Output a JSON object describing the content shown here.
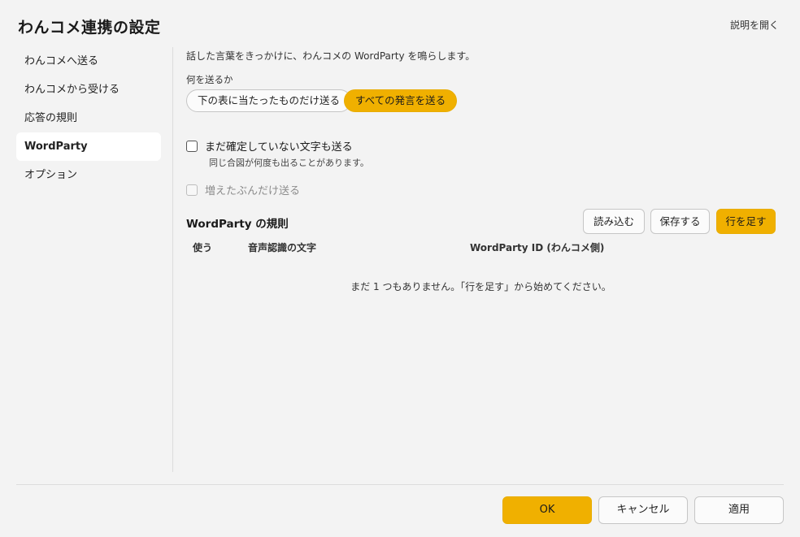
{
  "window": {
    "title": "わんコメ連携の設定",
    "help_link": "説明を開く"
  },
  "sidebar": {
    "items": [
      {
        "label": "わんコメへ送る",
        "active": false
      },
      {
        "label": "わんコメから受ける",
        "active": false
      },
      {
        "label": "応答の規則",
        "active": false
      },
      {
        "label": "WordParty",
        "active": true
      },
      {
        "label": "オプション",
        "active": false
      }
    ]
  },
  "main": {
    "description": "話した言葉をきっかけに、わんコメの WordParty を鳴らします。",
    "send_mode": {
      "label": "何を送るか",
      "options": [
        "下の表に当たったものだけ送る",
        "すべての発言を送る"
      ],
      "selected": "すべての発言を送る"
    },
    "send_unconfirmed": {
      "label": "まだ確定していない文字も送る",
      "hint": "同じ合図が何度も出ることがあります。",
      "checked": false
    },
    "send_increment": {
      "label": "増えたぶんだけ送る",
      "checked": false,
      "disabled": true
    },
    "rules": {
      "title": "WordParty の規則",
      "buttons": {
        "load": "読み込む",
        "save": "保存する",
        "add_row": "行を足す"
      },
      "columns": [
        "使う",
        "音声認識の文字",
        "WordParty ID (わんコメ側)"
      ],
      "rows": [],
      "empty_message": "まだ 1 つもありません。「行を足す」から始めてください。"
    }
  },
  "footer": {
    "ok": "OK",
    "cancel": "キャンセル",
    "apply": "適用"
  },
  "colors": {
    "accent": "#f0b000",
    "background": "#f3f3f3",
    "active_nav": "#ffffff"
  }
}
